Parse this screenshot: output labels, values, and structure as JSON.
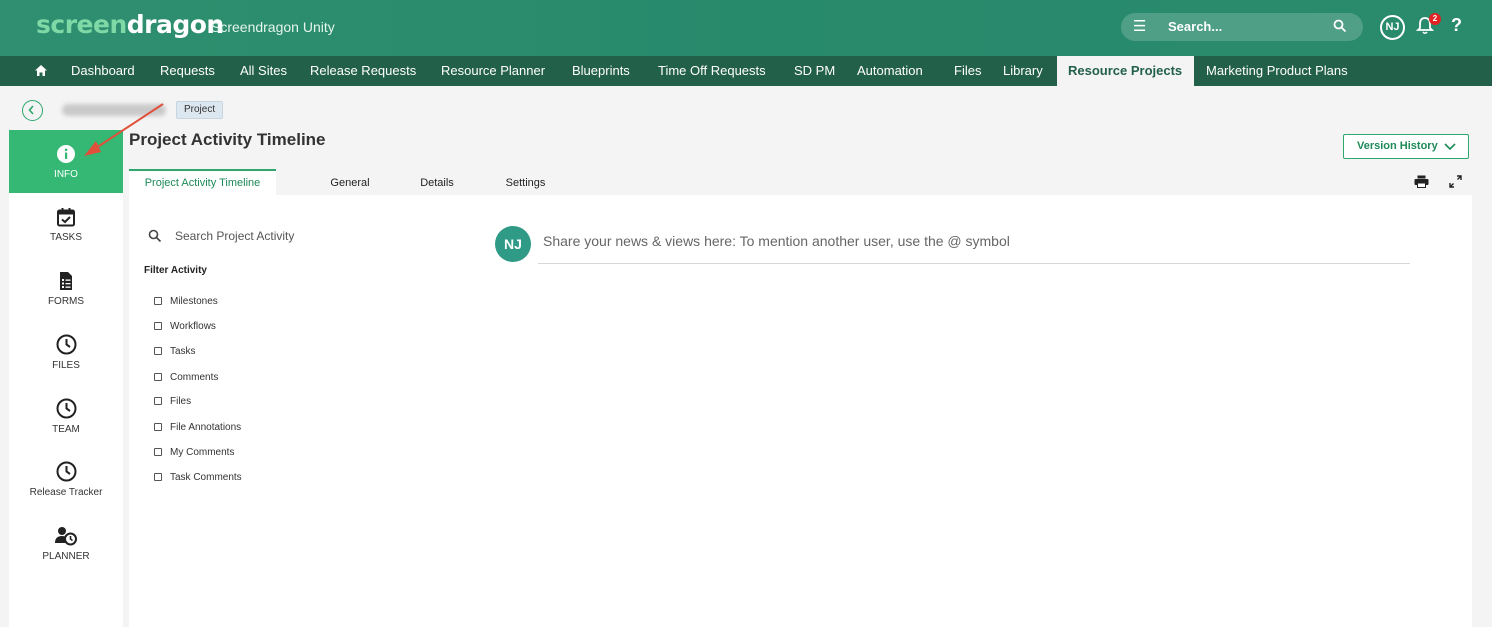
{
  "header": {
    "logo_a": "screen",
    "logo_b": "dragon",
    "app_name": "Screendragon Unity",
    "search_placeholder": "Search...",
    "avatar_initials": "NJ",
    "notification_count": "2",
    "help_label": "?"
  },
  "nav": {
    "items": [
      {
        "label": "Dashboard"
      },
      {
        "label": "Requests"
      },
      {
        "label": "All Sites"
      },
      {
        "label": "Release Requests"
      },
      {
        "label": "Resource Planner"
      },
      {
        "label": "Blueprints"
      },
      {
        "label": "Time Off Requests"
      },
      {
        "label": "SD PM"
      },
      {
        "label": "Automation"
      },
      {
        "label": "Files"
      },
      {
        "label": "Library"
      },
      {
        "label": "Resource Projects",
        "active": true
      },
      {
        "label": "Marketing Product Plans"
      }
    ]
  },
  "breadcrumb": {
    "tag": "Project"
  },
  "sidebar": {
    "items": [
      {
        "label": "INFO",
        "icon": "info-icon",
        "active": true
      },
      {
        "label": "TASKS",
        "icon": "calendar-check-icon"
      },
      {
        "label": "FORMS",
        "icon": "form-icon"
      },
      {
        "label": "FILES",
        "icon": "clock-icon"
      },
      {
        "label": "TEAM",
        "icon": "clock-icon"
      },
      {
        "label": "Release Tracker",
        "icon": "clock-icon"
      },
      {
        "label": "PLANNER",
        "icon": "user-clock-icon"
      }
    ]
  },
  "main": {
    "title": "Project Activity Timeline",
    "version_history_label": "Version History",
    "tabs": [
      {
        "label": "Project Activity Timeline",
        "active": true
      },
      {
        "label": "General"
      },
      {
        "label": "Details"
      },
      {
        "label": "Settings"
      }
    ],
    "search_label": "Search Project Activity",
    "filter_title": "Filter Activity",
    "filters": [
      {
        "label": "Milestones",
        "checked": false
      },
      {
        "label": "Workflows",
        "checked": false
      },
      {
        "label": "Tasks",
        "checked": false
      },
      {
        "label": "Comments",
        "checked": false
      },
      {
        "label": "Files",
        "checked": false
      },
      {
        "label": "File Annotations",
        "checked": false
      },
      {
        "label": "My Comments",
        "checked": false
      },
      {
        "label": "Task Comments",
        "checked": false
      }
    ],
    "post_avatar": "NJ",
    "post_placeholder": "Share your news & views here:  To mention another user, use the @ symbol"
  },
  "colors": {
    "header_green": "#2a8a6c",
    "nav_green": "#22604a",
    "accent_green": "#34b873",
    "annotation_red": "#e0503a"
  }
}
